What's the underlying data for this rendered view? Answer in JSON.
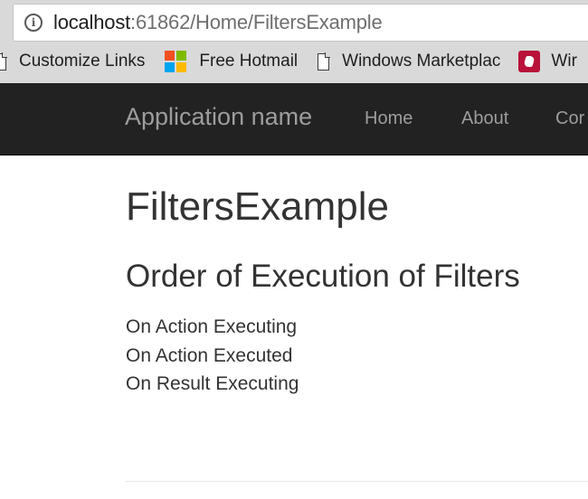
{
  "browser": {
    "url_host": "localhost",
    "url_rest": ":61862/Home/FiltersExample",
    "bookmarks": [
      {
        "label": "Customize Links",
        "icon": "page-icon"
      },
      {
        "label": "Free Hotmail",
        "icon": "microsoft-logo-icon"
      },
      {
        "label": "Windows Marketplac",
        "icon": "page-icon"
      },
      {
        "label": "Wir",
        "icon": "windows-media-icon"
      }
    ],
    "colors": {
      "ms_red": "#f25022",
      "ms_green": "#7fba00",
      "ms_blue": "#00a4ef",
      "ms_yellow": "#ffb900"
    }
  },
  "navbar": {
    "brand": "Application name",
    "items": [
      "Home",
      "About",
      "Cor"
    ],
    "background": "#222222",
    "text_color": "#9d9d9d"
  },
  "main": {
    "title": "FiltersExample",
    "section_title": "Order of Execution of Filters",
    "filters": [
      "On Action Executing",
      "On Action Executed",
      "On Result Executing"
    ]
  }
}
